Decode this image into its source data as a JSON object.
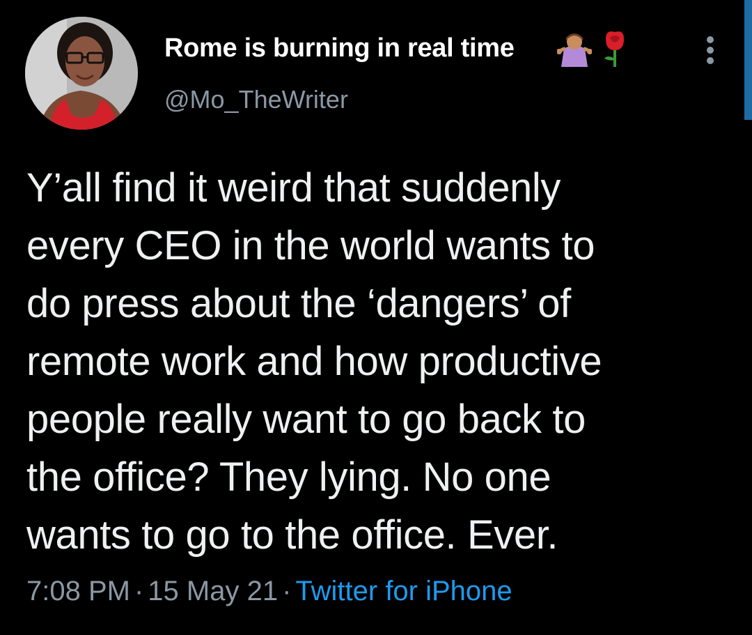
{
  "tweet": {
    "display_name": "Rome is burning in real time",
    "name_emojis": [
      "person-shrugging-icon",
      "rose-icon"
    ],
    "handle": "@Mo_TheWriter",
    "text_lines": [
      "Y’all find it weird that suddenly",
      "every CEO in the world wants to",
      "do press about the ‘dangers’ of",
      "remote work and how productive",
      "people really want to go back to",
      "the office? They lying. No one",
      "wants to go to the office. Ever."
    ],
    "time": "7:08 PM",
    "separator": "·",
    "date": "15 May 21",
    "source": "Twitter for iPhone"
  },
  "colors": {
    "background": "#000000",
    "name": "#ffffff",
    "secondary": "#8b98a5",
    "link": "#1d9bf0"
  }
}
